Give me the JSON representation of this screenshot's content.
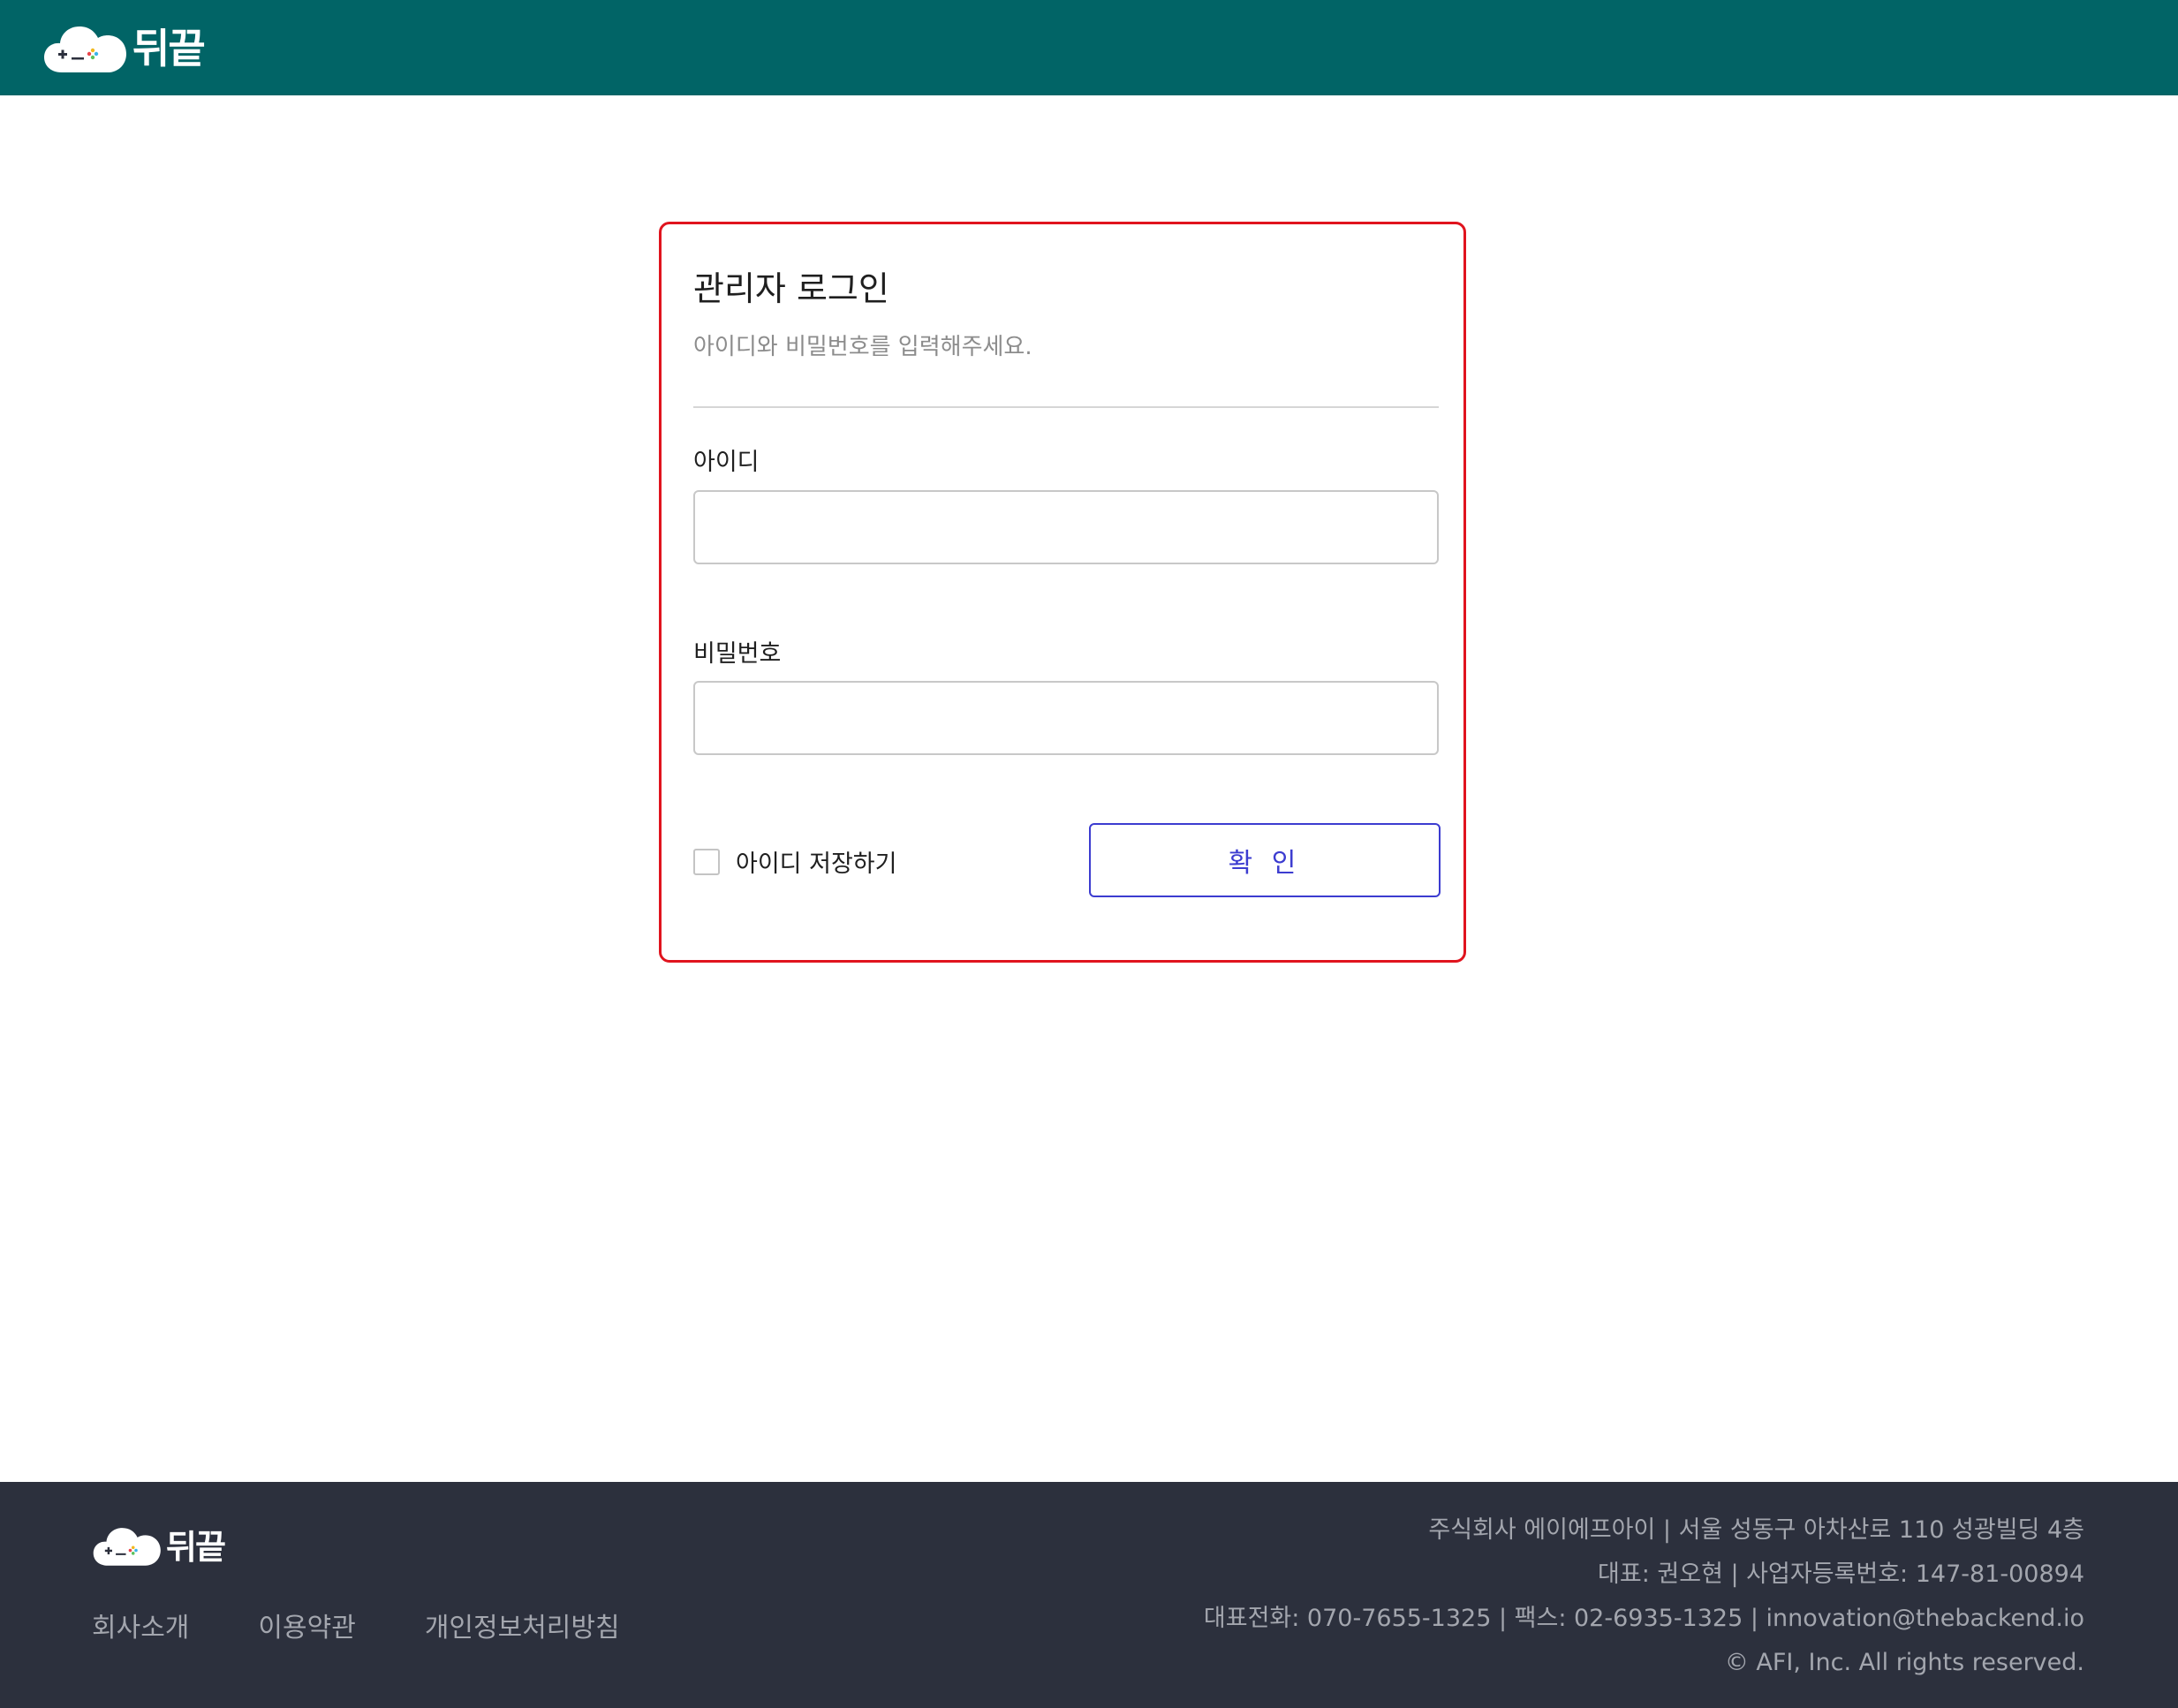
{
  "header": {
    "logo_text": "뒤끝"
  },
  "login": {
    "title": "관리자 로그인",
    "subtitle": "아이디와 비밀번호를 입력해주세요.",
    "id_label": "아이디",
    "id_value": "",
    "password_label": "비밀번호",
    "password_value": "",
    "remember_label": "아이디 저장하기",
    "remember_checked": false,
    "confirm_label": "확 인"
  },
  "footer": {
    "logo_text": "뒤끝",
    "links": [
      "회사소개",
      "이용약관",
      "개인정보처리방침"
    ],
    "info": [
      "주식회사 에이에프아이 | 서울 성동구 아차산로 110 성광빌딩 4층",
      "대표: 권오현 | 사업자등록번호: 147-81-00894",
      "대표전화: 070-7655-1325 | 팩스: 02-6935-1325 | innovation@thebackend.io",
      "© AFI, Inc. All rights reserved."
    ]
  },
  "colors": {
    "header_bg": "#016466",
    "footer_bg": "#2c303d",
    "card_border": "#e0141e",
    "confirm_accent": "#3c3cd0"
  }
}
